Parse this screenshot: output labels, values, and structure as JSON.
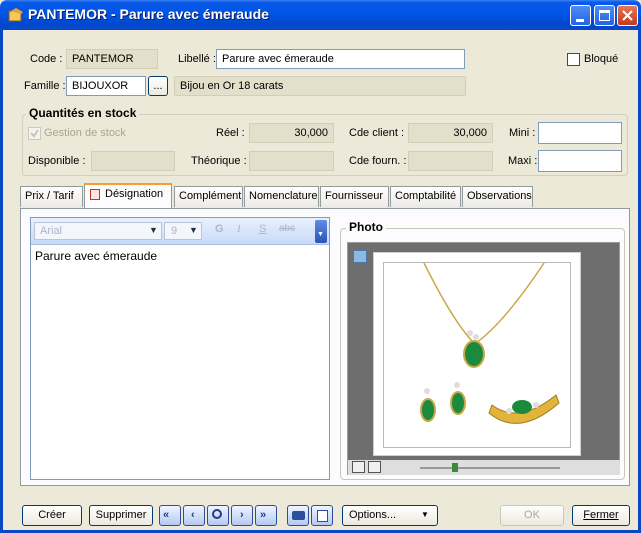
{
  "window": {
    "title": "PANTEMOR - Parure avec émeraude"
  },
  "header": {
    "code_label": "Code :",
    "code_value": "PANTEMOR",
    "libelle_label": "Libellé :",
    "libelle_value": "Parure avec émeraude",
    "bloque_label": "Bloqué",
    "famille_label": "Famille :",
    "famille_value": "BIJOUXOR",
    "famille_button": "...",
    "famille_desc": "Bijou en Or 18 carats"
  },
  "stock": {
    "title": "Quantités en stock",
    "gestion_label": "Gestion de stock",
    "reel_label": "Réel :",
    "reel_value": "30,000",
    "cde_client_label": "Cde client :",
    "cde_client_value": "30,000",
    "mini_label": "Mini :",
    "mini_value": "",
    "disponible_label": "Disponible :",
    "disponible_value": "",
    "theorique_label": "Théorique :",
    "theorique_value": "",
    "cde_fourn_label": "Cde fourn. :",
    "cde_fourn_value": "",
    "maxi_label": "Maxi :",
    "maxi_value": ""
  },
  "tabs": [
    "Prix / Tarif",
    "Désignation",
    "Complément",
    "Nomenclature",
    "Fournisseur",
    "Comptabilité",
    "Observations"
  ],
  "active_tab": "Désignation",
  "editor": {
    "font": "Arial",
    "size": "9",
    "bold": "G",
    "italic": "I",
    "underline": "S",
    "strike": "abc",
    "content": "Parure avec émeraude"
  },
  "photo": {
    "title": "Photo"
  },
  "bottom": {
    "creer": "Créer",
    "supprimer": "Supprimer",
    "options": "Options...",
    "ok": "OK",
    "fermer": "Fermer"
  },
  "colors": {
    "titlebar": "#0055e5",
    "tab_highlight": "#f3a034",
    "window_bg": "#ece9d8"
  }
}
